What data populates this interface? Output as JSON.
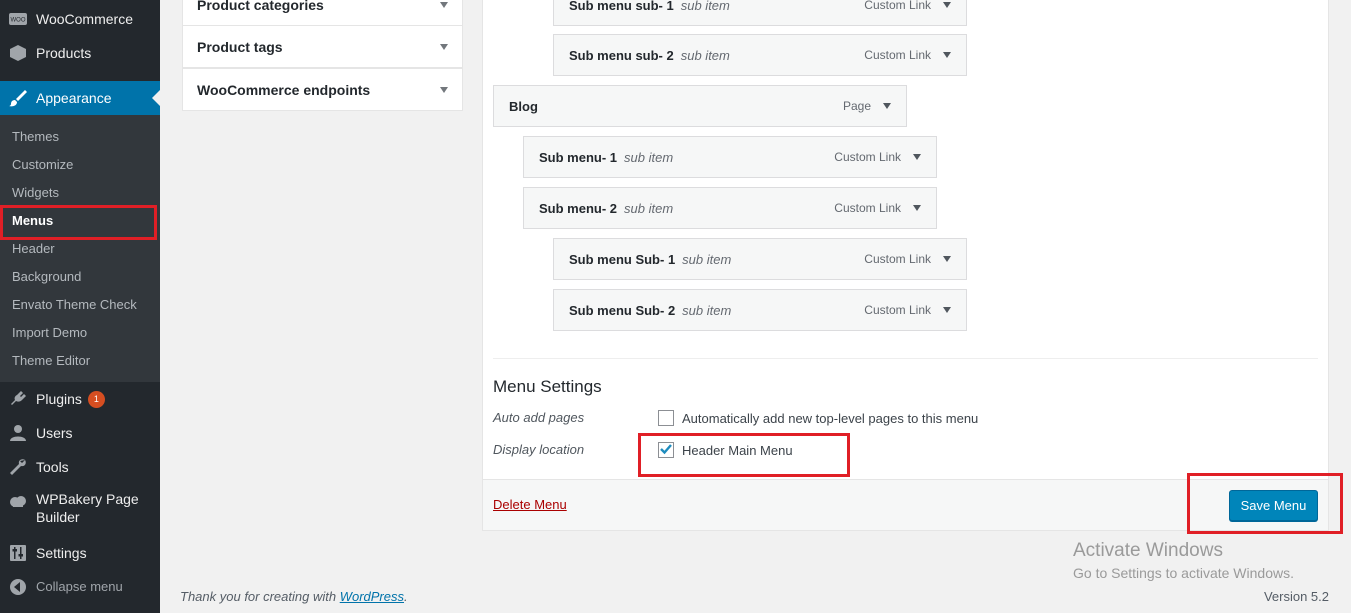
{
  "sidebar": {
    "woocommerce": "WooCommerce",
    "products": "Products",
    "appearance": "Appearance",
    "submenu": [
      "Themes",
      "Customize",
      "Widgets",
      "Menus",
      "Header",
      "Background",
      "Envato Theme Check",
      "Import Demo",
      "Theme Editor"
    ],
    "plugins": "Plugins",
    "plugins_badge": "1",
    "users": "Users",
    "tools": "Tools",
    "wpbakery_line1": "WPBakery Page",
    "wpbakery_line2": "Builder",
    "settings": "Settings",
    "collapse": "Collapse menu",
    "woo_logo": "WOO"
  },
  "accordion": [
    "Product categories",
    "Product tags",
    "WooCommerce endpoints"
  ],
  "menu_items": [
    {
      "title": "Sub menu sub- 1",
      "sub": "sub item",
      "type": "Custom Link"
    },
    {
      "title": "Sub menu sub- 2",
      "sub": "sub item",
      "type": "Custom Link"
    },
    {
      "title": "Blog",
      "sub": "",
      "type": "Page"
    },
    {
      "title": "Sub menu- 1",
      "sub": "sub item",
      "type": "Custom Link"
    },
    {
      "title": "Sub menu- 2",
      "sub": "sub item",
      "type": "Custom Link"
    },
    {
      "title": "Sub menu Sub- 1",
      "sub": "sub item",
      "type": "Custom Link"
    },
    {
      "title": "Sub menu Sub- 2",
      "sub": "sub item",
      "type": "Custom Link"
    }
  ],
  "menu_settings": {
    "title": "Menu Settings",
    "auto_add_label": "Auto add pages",
    "auto_add_text": "Automatically add new top-level pages to this menu",
    "auto_add_checked": false,
    "display_location_label": "Display location",
    "location_text": "Header Main Menu",
    "location_checked": true
  },
  "footer_actions": {
    "delete": "Delete Menu",
    "save": "Save Menu"
  },
  "watermark": {
    "title": "Activate Windows",
    "subtitle": "Go to Settings to activate Windows."
  },
  "page_footer": {
    "thanks_prefix": "Thank you for creating with ",
    "thanks_link": "WordPress",
    "thanks_suffix": ".",
    "version": "Version 5.2"
  },
  "colors": {
    "sidebar_bg": "#23282d",
    "active_blue": "#0073aa",
    "highlight_red": "#e01f26",
    "button_blue": "#0085ba"
  }
}
